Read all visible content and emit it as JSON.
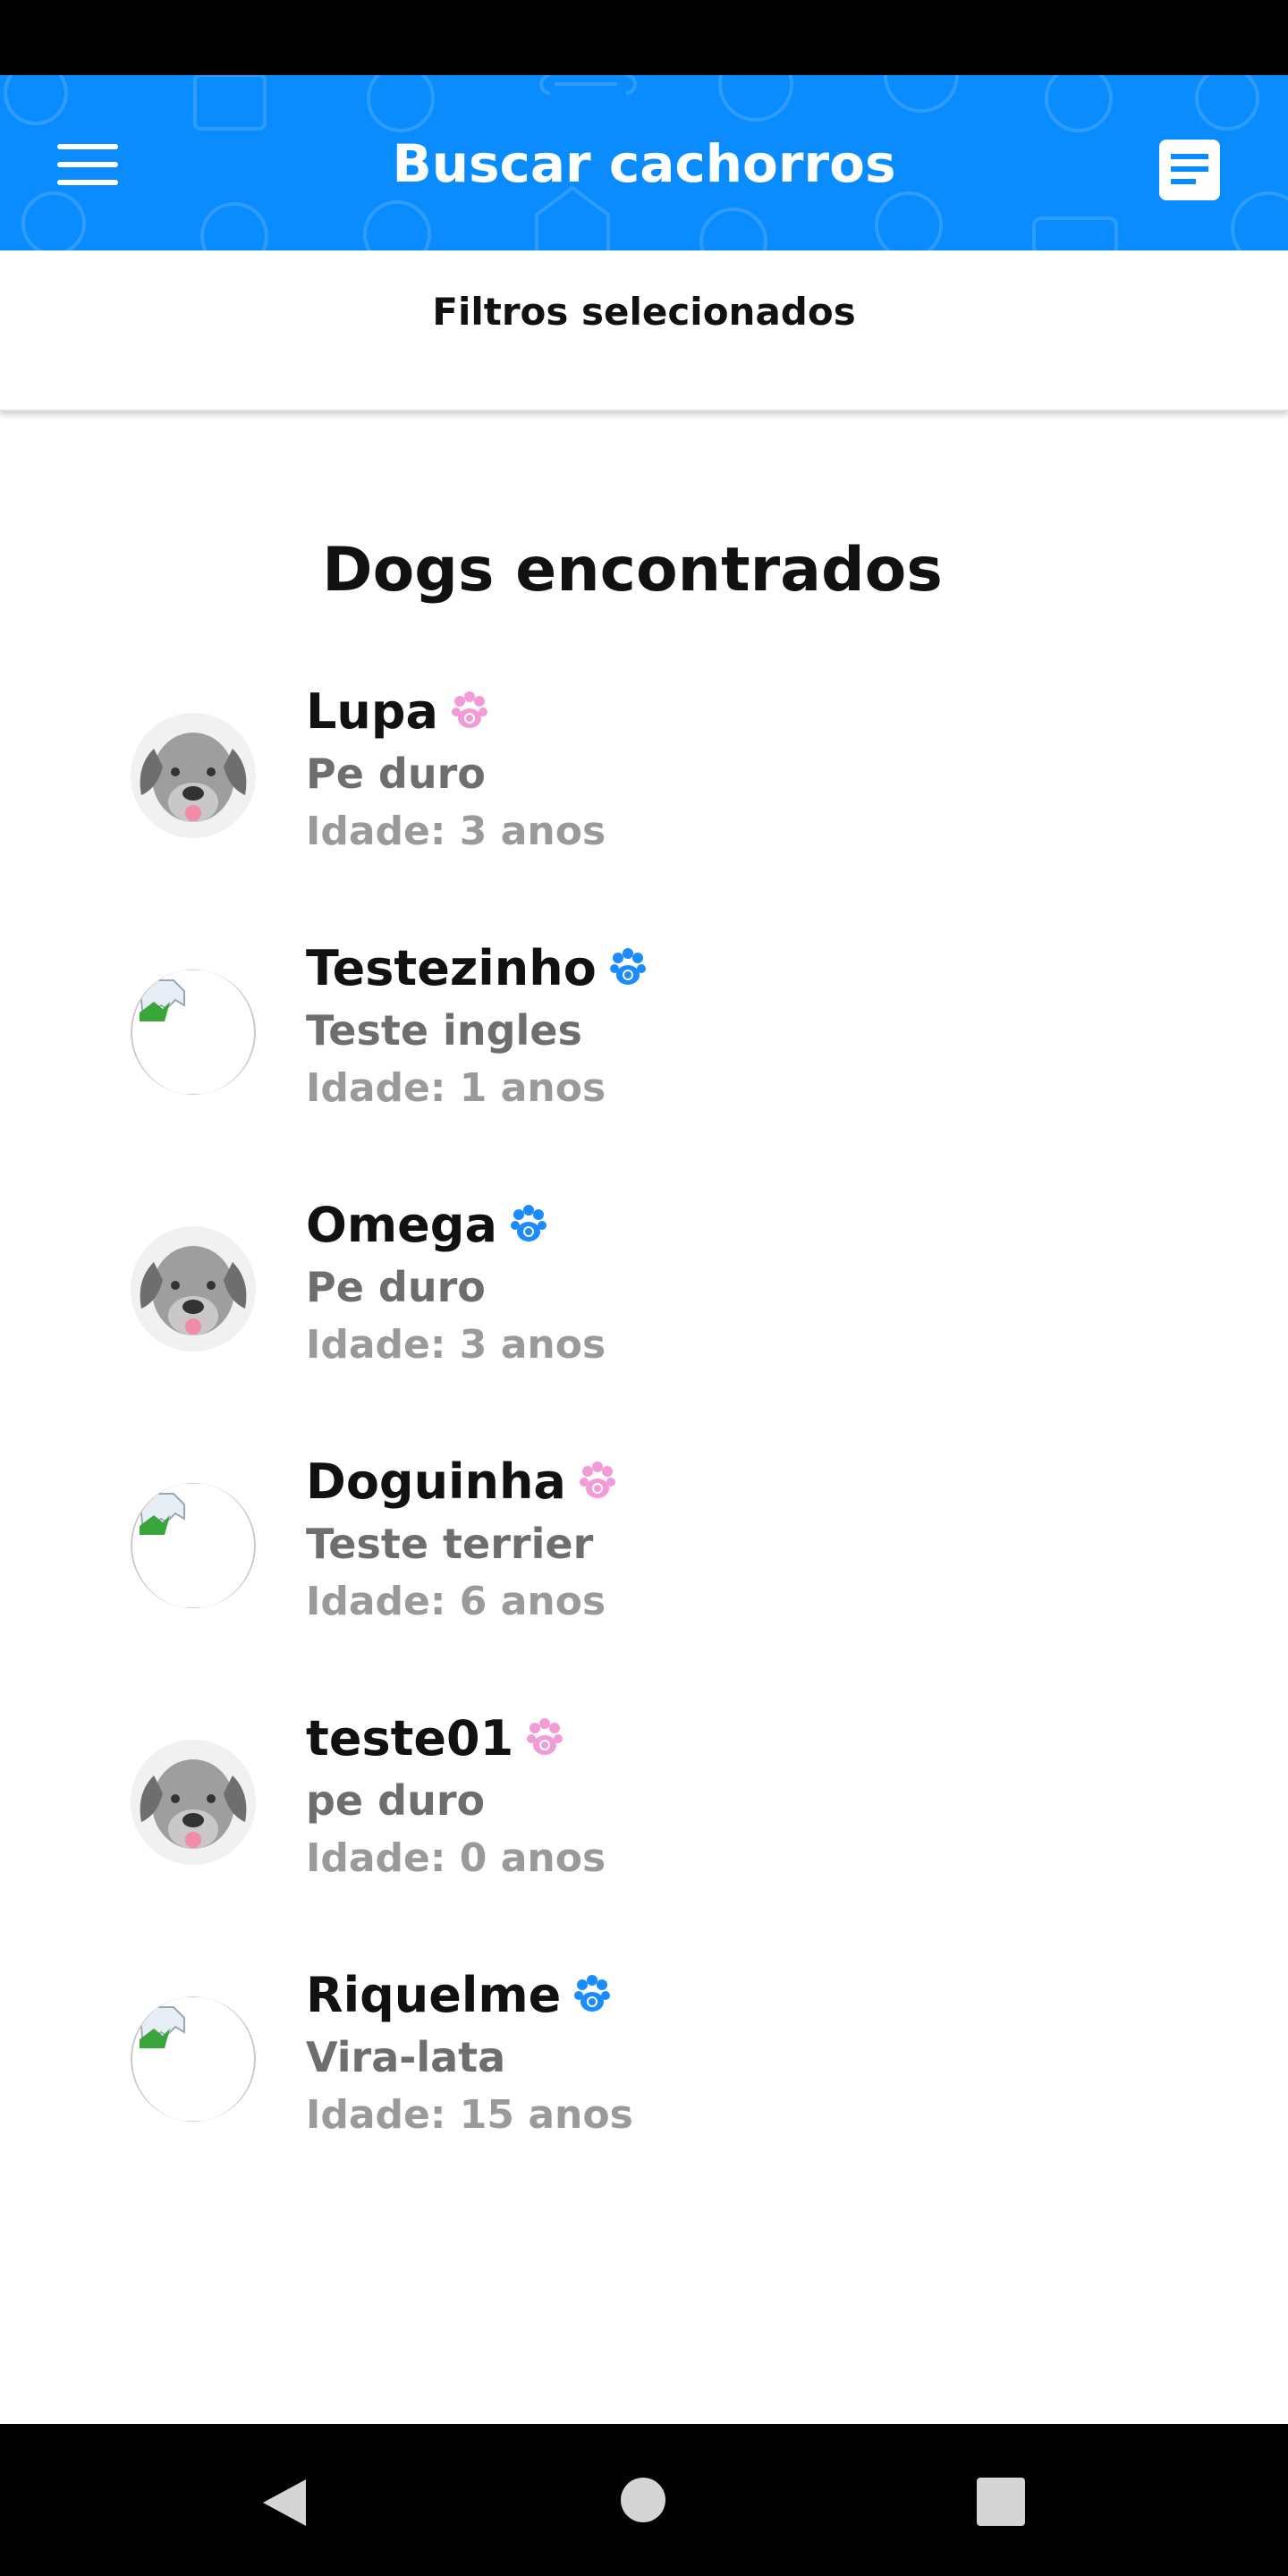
{
  "app_bar": {
    "title": "Buscar cachorros",
    "menu_icon": "hamburger-menu-icon",
    "action_icon": "document-icon",
    "background_color": "#0a8cff"
  },
  "filters": {
    "label": "Filtros selecionados"
  },
  "results": {
    "title": "Dogs encontrados",
    "dogs": [
      {
        "name": "Lupa",
        "breed": "Pe duro",
        "age": "Idade: 3 anos",
        "sex_icon_color": "#f29bd6",
        "avatar": "dog-avatar"
      },
      {
        "name": "Testezinho",
        "breed": "Teste ingles",
        "age": "Idade: 1 anos",
        "sex_icon_color": "#1a8cff",
        "avatar": "broken-image"
      },
      {
        "name": "Omega",
        "breed": "Pe duro",
        "age": "Idade: 3 anos",
        "sex_icon_color": "#1a8cff",
        "avatar": "dog-avatar"
      },
      {
        "name": "Doguinha",
        "breed": "Teste terrier",
        "age": "Idade: 6 anos",
        "sex_icon_color": "#f29bd6",
        "avatar": "broken-image"
      },
      {
        "name": "teste01",
        "breed": "pe duro",
        "age": "Idade: 0 anos",
        "sex_icon_color": "#f29bd6",
        "avatar": "dog-avatar"
      },
      {
        "name": "Riquelme",
        "breed": "Vira-lata",
        "age": "Idade: 15 anos",
        "sex_icon_color": "#1a8cff",
        "avatar": "broken-image"
      }
    ]
  },
  "nav": {
    "back_icon": "back-triangle-icon",
    "home_icon": "home-circle-icon",
    "recents_icon": "recents-square-icon"
  }
}
